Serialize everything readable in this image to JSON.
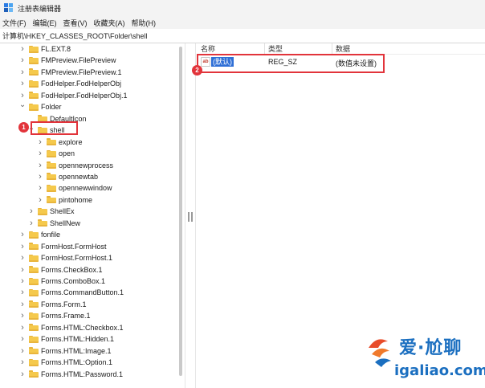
{
  "window": {
    "title": "注册表编辑器"
  },
  "menu": [
    "文件(F)",
    "编辑(E)",
    "查看(V)",
    "收藏夹(A)",
    "帮助(H)"
  ],
  "address": "计算机\\HKEY_CLASSES_ROOT\\Folder\\shell",
  "tree": [
    {
      "label": "FL.EXT.8",
      "level": 0,
      "chevron": ">"
    },
    {
      "label": "FMPreview.FilePreview",
      "level": 0,
      "chevron": ">"
    },
    {
      "label": "FMPreview.FilePreview.1",
      "level": 0,
      "chevron": ">"
    },
    {
      "label": "FodHelper.FodHelperObj",
      "level": 0,
      "chevron": ">"
    },
    {
      "label": "FodHelper.FodHelperObj.1",
      "level": 0,
      "chevron": ">"
    },
    {
      "label": "Folder",
      "level": 0,
      "chevron": "v"
    },
    {
      "label": "DefaultIcon",
      "level": 1,
      "chevron": ""
    },
    {
      "label": "shell",
      "level": 1,
      "chevron": "v"
    },
    {
      "label": "explore",
      "level": 2,
      "chevron": ">"
    },
    {
      "label": "open",
      "level": 2,
      "chevron": ">"
    },
    {
      "label": "opennewprocess",
      "level": 2,
      "chevron": ">"
    },
    {
      "label": "opennewtab",
      "level": 2,
      "chevron": ">"
    },
    {
      "label": "opennewwindow",
      "level": 2,
      "chevron": ">"
    },
    {
      "label": "pintohome",
      "level": 2,
      "chevron": ">"
    },
    {
      "label": "ShellEx",
      "level": 1,
      "chevron": ">"
    },
    {
      "label": "ShellNew",
      "level": 1,
      "chevron": ">"
    },
    {
      "label": "fonfile",
      "level": 0,
      "chevron": ">"
    },
    {
      "label": "FormHost.FormHost",
      "level": 0,
      "chevron": ">"
    },
    {
      "label": "FormHost.FormHost.1",
      "level": 0,
      "chevron": ">"
    },
    {
      "label": "Forms.CheckBox.1",
      "level": 0,
      "chevron": ">"
    },
    {
      "label": "Forms.ComboBox.1",
      "level": 0,
      "chevron": ">"
    },
    {
      "label": "Forms.CommandButton.1",
      "level": 0,
      "chevron": ">"
    },
    {
      "label": "Forms.Form.1",
      "level": 0,
      "chevron": ">"
    },
    {
      "label": "Forms.Frame.1",
      "level": 0,
      "chevron": ">"
    },
    {
      "label": "Forms.HTML:Checkbox.1",
      "level": 0,
      "chevron": ">"
    },
    {
      "label": "Forms.HTML:Hidden.1",
      "level": 0,
      "chevron": ">"
    },
    {
      "label": "Forms.HTML:Image.1",
      "level": 0,
      "chevron": ">"
    },
    {
      "label": "Forms.HTML:Option.1",
      "level": 0,
      "chevron": ">"
    },
    {
      "label": "Forms.HTML:Password.1",
      "level": 0,
      "chevron": ">"
    }
  ],
  "values_panel": {
    "columns": [
      "名称",
      "类型",
      "数据"
    ],
    "rows": [
      {
        "name": "(默认)",
        "type": "REG_SZ",
        "data": "(数值未设置)",
        "icon": "ab-string-icon"
      }
    ]
  },
  "markers": [
    "1",
    "2"
  ],
  "watermark": {
    "line1": "爱·尬聊",
    "line2": "igaliao.com"
  },
  "colors": {
    "highlight": "#e2343b",
    "selection": "#2f6fd6",
    "folder": "#f5c94c",
    "watermark": "#1b6fc0"
  }
}
